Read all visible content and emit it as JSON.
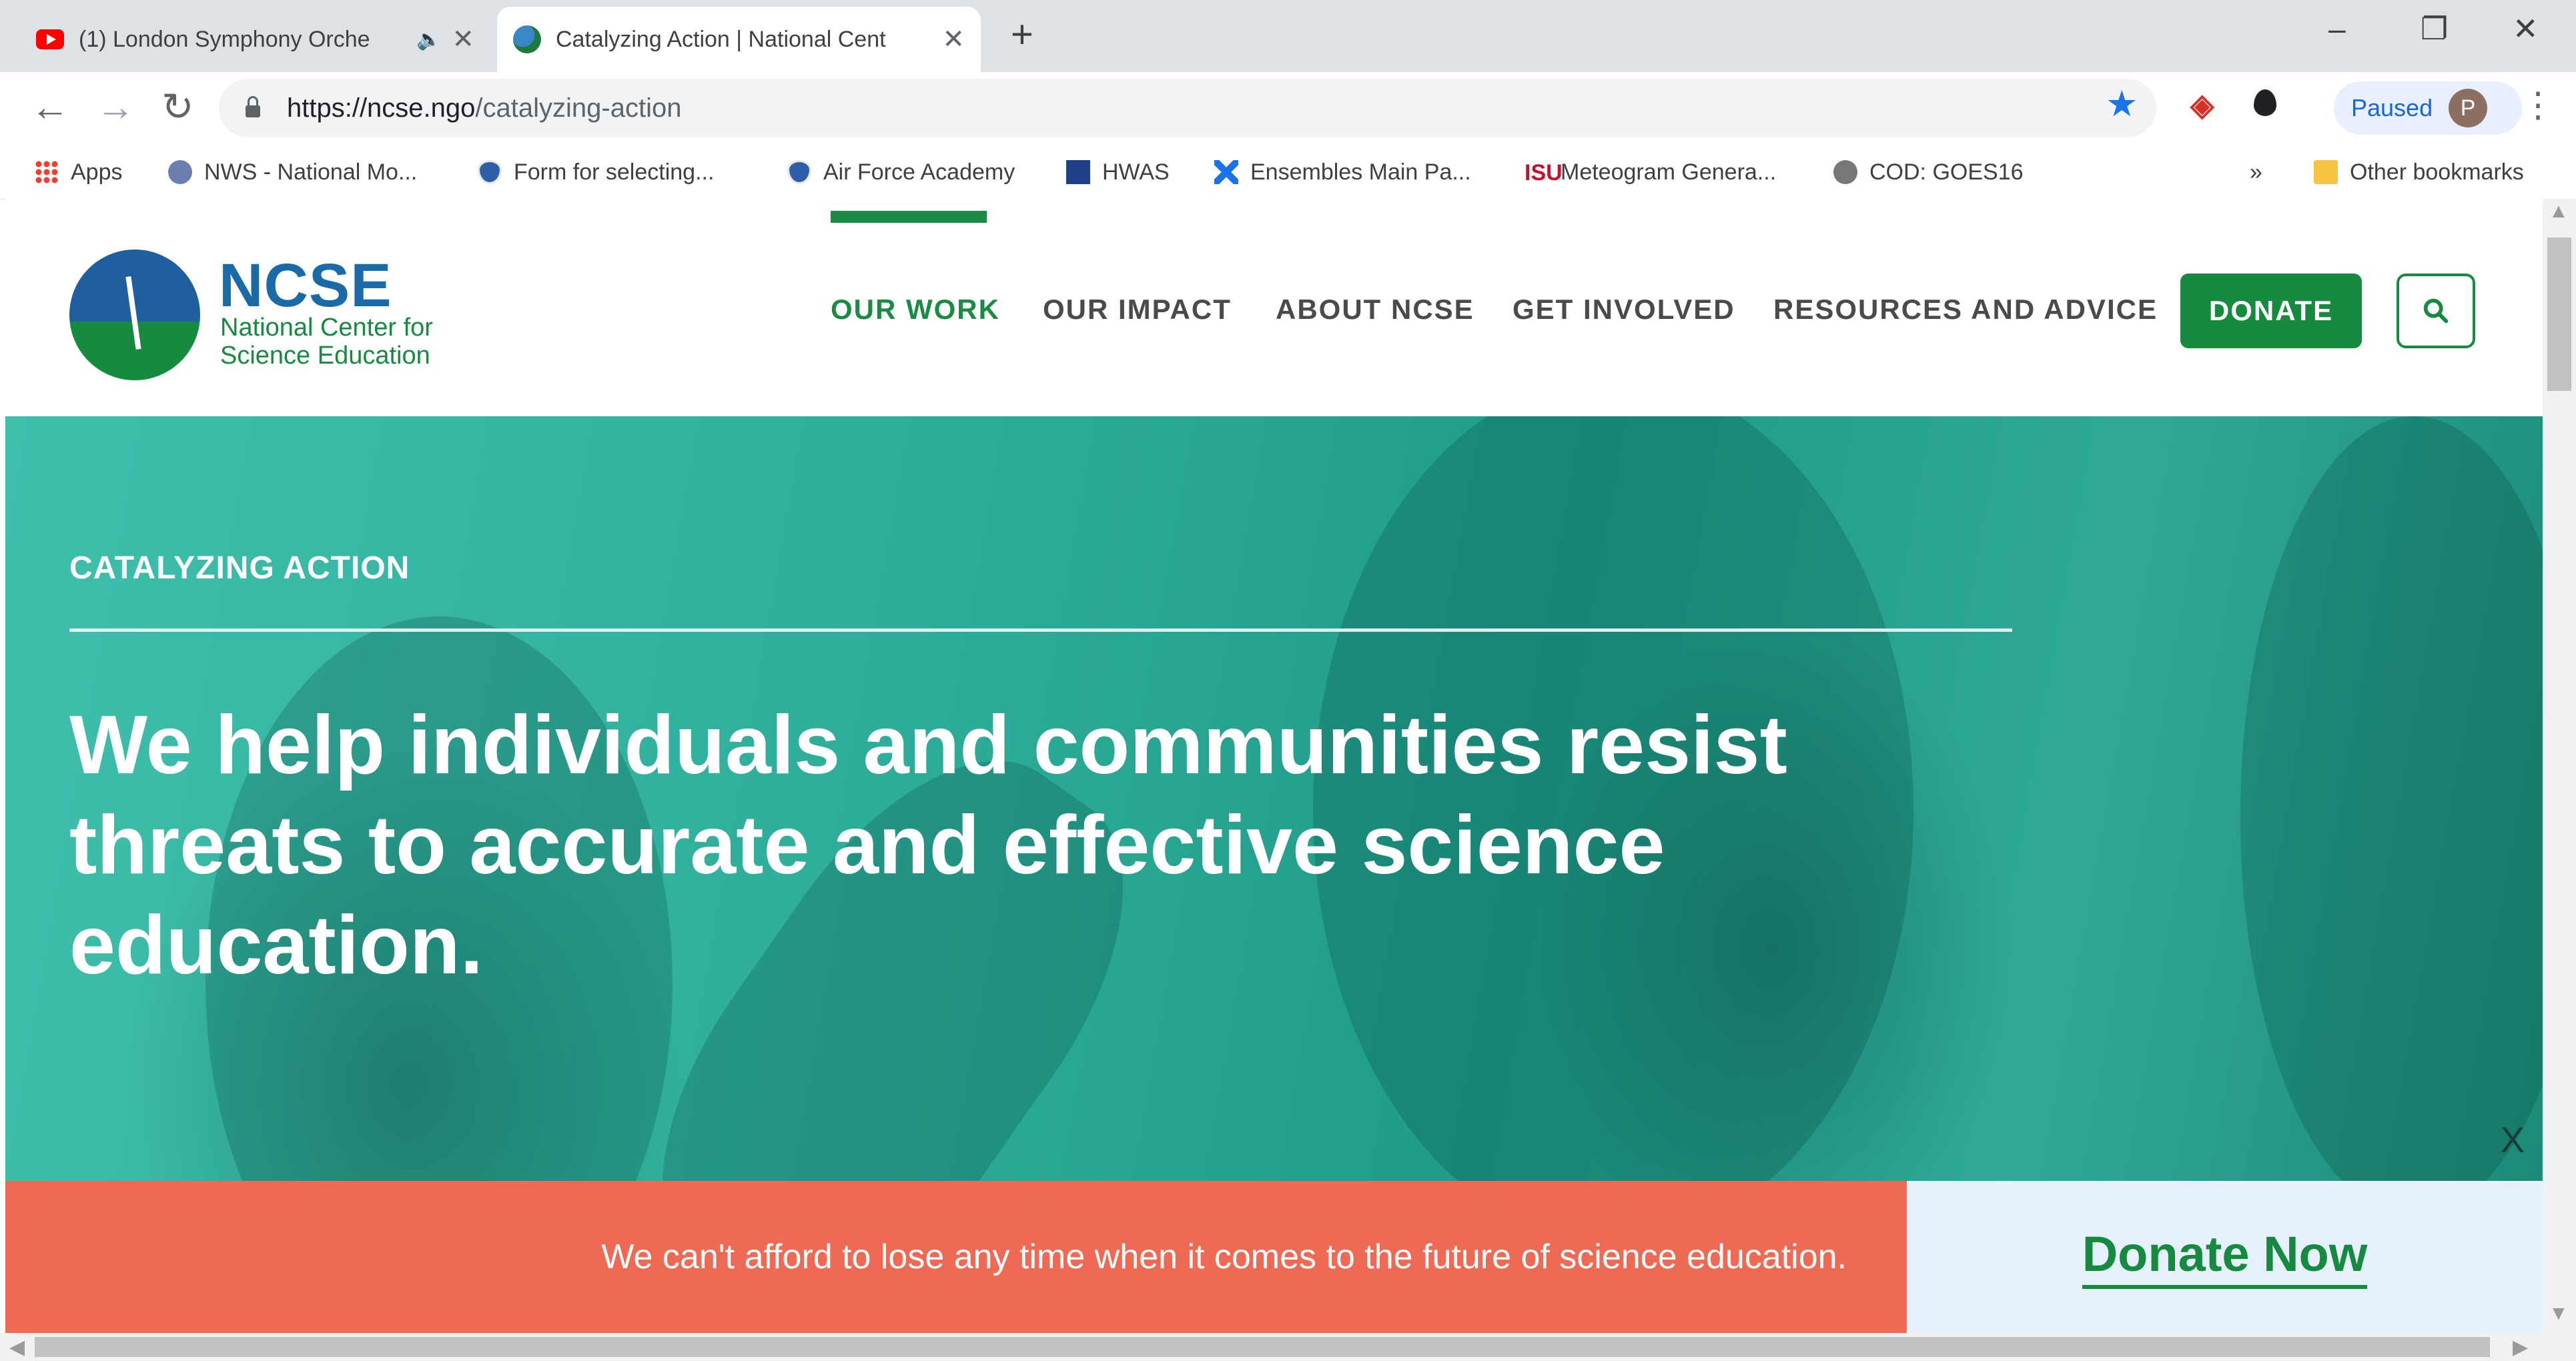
{
  "browser": {
    "tabs": [
      {
        "title": "(1) London Symphony Orche",
        "icon": "youtube-icon"
      },
      {
        "title": "Catalyzing Action | National Cent",
        "icon": "globe-icon"
      }
    ],
    "new_tab": "+",
    "window_controls": {
      "minimize": "–",
      "restore": "❐",
      "close": "✕"
    },
    "url": {
      "host": "https://ncse.ngo",
      "path": "/catalyzing-action"
    },
    "profile": {
      "status": "Paused",
      "initial": "P"
    },
    "bookmarks": [
      {
        "label": "Apps",
        "icon": "apps-icon"
      },
      {
        "label": "NWS - National Mo...",
        "icon": "nws-icon"
      },
      {
        "label": "Form for selecting...",
        "icon": "shield-icon"
      },
      {
        "label": "Air Force Academy",
        "icon": "shield-icon"
      },
      {
        "label": "HWAS",
        "icon": "hwas-icon"
      },
      {
        "label": "Ensembles Main Pa...",
        "icon": "ensembles-icon"
      },
      {
        "label": "Meteogram Genera...",
        "icon": "isu-icon",
        "badge": "ISU"
      },
      {
        "label": "COD: GOES16",
        "icon": "cod-icon"
      }
    ],
    "bookmarks_overflow": "»",
    "other_bookmarks": "Other bookmarks"
  },
  "site": {
    "logo_text": "NCSE",
    "logo_sub": "National Center for Science Education",
    "nav": [
      "OUR WORK",
      "OUR IMPACT",
      "ABOUT NCSE",
      "GET INVOLVED",
      "RESOURCES AND ADVICE"
    ],
    "active_nav": "OUR WORK",
    "donate": "DONATE",
    "colors": {
      "brand_green": "#168a3e",
      "brand_blue": "#1b6aa8",
      "hero_teal": "#2eae9a",
      "banner_coral": "#ef6a55"
    }
  },
  "hero": {
    "label": "CATALYZING ACTION",
    "heading": "We help individuals and communities resist threats to accurate and effective science education.",
    "close": "X"
  },
  "banner": {
    "text": "We can't afford to lose any time when it comes to the future of science education.",
    "cta": "Donate Now"
  }
}
